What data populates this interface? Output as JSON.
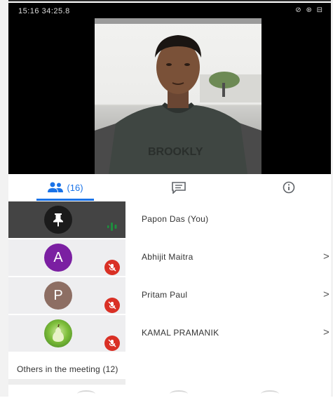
{
  "status_bar": {
    "time": "15:16 34:25.8",
    "icons": "⊘ ⊛ ⊟"
  },
  "tabs": {
    "people_count": "(16)",
    "active": "people"
  },
  "participants": [
    {
      "name": "Papon Das (You)",
      "avatar": "pin",
      "initial": ""
    },
    {
      "name": "Abhijit Maitra",
      "avatar": "purple",
      "initial": "A",
      "chevron": ">"
    },
    {
      "name": "Pritam Paul",
      "avatar": "brown",
      "initial": "P",
      "chevron": ">"
    },
    {
      "name": "KAMAL PRAMANIK",
      "avatar": "photo",
      "initial": "",
      "chevron": ">"
    }
  ],
  "others_label": "Others in the meeting (12)",
  "colors": {
    "accent": "#1a73e8",
    "muted": "#d93025",
    "audio": "#1e8e3e"
  }
}
